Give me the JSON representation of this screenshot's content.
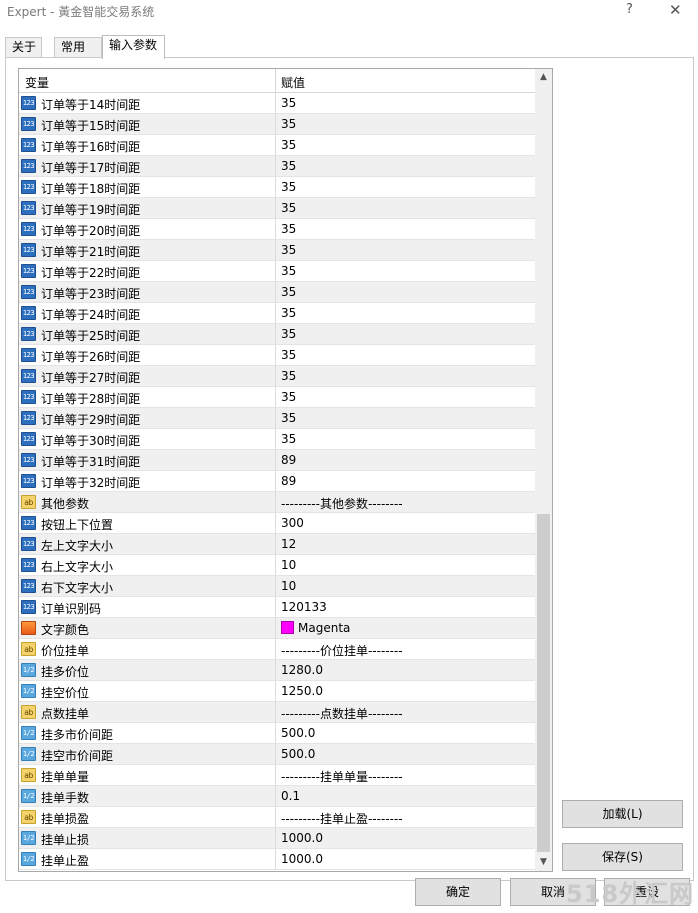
{
  "window": {
    "title": "Expert - 黃金智能交易系统",
    "help_glyph": "?",
    "close_glyph": "✕"
  },
  "tabs": [
    "关于",
    "常用",
    "输入参数"
  ],
  "grid": {
    "headers": [
      "变量",
      "赋值"
    ],
    "rows": [
      {
        "icon": "int",
        "icon_text": "123",
        "name": "订单等于14时间距",
        "value": "35"
      },
      {
        "icon": "int",
        "icon_text": "123",
        "name": "订单等于15时间距",
        "value": "35"
      },
      {
        "icon": "int",
        "icon_text": "123",
        "name": "订单等于16时间距",
        "value": "35"
      },
      {
        "icon": "int",
        "icon_text": "123",
        "name": "订单等于17时间距",
        "value": "35"
      },
      {
        "icon": "int",
        "icon_text": "123",
        "name": "订单等于18时间距",
        "value": "35"
      },
      {
        "icon": "int",
        "icon_text": "123",
        "name": "订单等于19时间距",
        "value": "35"
      },
      {
        "icon": "int",
        "icon_text": "123",
        "name": "订单等于20时间距",
        "value": "35"
      },
      {
        "icon": "int",
        "icon_text": "123",
        "name": "订单等于21时间距",
        "value": "35"
      },
      {
        "icon": "int",
        "icon_text": "123",
        "name": "订单等于22时间距",
        "value": "35"
      },
      {
        "icon": "int",
        "icon_text": "123",
        "name": "订单等于23时间距",
        "value": "35"
      },
      {
        "icon": "int",
        "icon_text": "123",
        "name": "订单等于24时间距",
        "value": "35"
      },
      {
        "icon": "int",
        "icon_text": "123",
        "name": "订单等于25时间距",
        "value": "35"
      },
      {
        "icon": "int",
        "icon_text": "123",
        "name": "订单等于26时间距",
        "value": "35"
      },
      {
        "icon": "int",
        "icon_text": "123",
        "name": "订单等于27时间距",
        "value": "35"
      },
      {
        "icon": "int",
        "icon_text": "123",
        "name": "订单等于28时间距",
        "value": "35"
      },
      {
        "icon": "int",
        "icon_text": "123",
        "name": "订单等于29时间距",
        "value": "35"
      },
      {
        "icon": "int",
        "icon_text": "123",
        "name": "订单等于30时间距",
        "value": "35"
      },
      {
        "icon": "int",
        "icon_text": "123",
        "name": "订单等于31时间距",
        "value": "89"
      },
      {
        "icon": "int",
        "icon_text": "123",
        "name": "订单等于32时间距",
        "value": "89"
      },
      {
        "icon": "str",
        "icon_text": "ab",
        "name": "其他参数",
        "value": "---------其他参数--------"
      },
      {
        "icon": "int",
        "icon_text": "123",
        "name": "按钮上下位置",
        "value": "300"
      },
      {
        "icon": "int",
        "icon_text": "123",
        "name": "左上文字大小",
        "value": "12"
      },
      {
        "icon": "int",
        "icon_text": "123",
        "name": "右上文字大小",
        "value": "10"
      },
      {
        "icon": "int",
        "icon_text": "123",
        "name": "右下文字大小",
        "value": "10"
      },
      {
        "icon": "int",
        "icon_text": "123",
        "name": "订单识别码",
        "value": "120133"
      },
      {
        "icon": "clr",
        "icon_text": "",
        "name": "文字颜色",
        "value": "Magenta",
        "swatch": "#ff00ff"
      },
      {
        "icon": "str",
        "icon_text": "ab",
        "name": "价位挂单",
        "value": "---------价位挂单--------"
      },
      {
        "icon": "dbl",
        "icon_text": "1/2",
        "name": "挂多价位",
        "value": "1280.0"
      },
      {
        "icon": "dbl",
        "icon_text": "1/2",
        "name": "挂空价位",
        "value": "1250.0"
      },
      {
        "icon": "str",
        "icon_text": "ab",
        "name": "点数挂单",
        "value": "---------点数挂单--------"
      },
      {
        "icon": "dbl",
        "icon_text": "1/2",
        "name": "挂多市价间距",
        "value": "500.0"
      },
      {
        "icon": "dbl",
        "icon_text": "1/2",
        "name": "挂空市价间距",
        "value": "500.0"
      },
      {
        "icon": "str",
        "icon_text": "ab",
        "name": "挂单单量",
        "value": "---------挂单单量--------"
      },
      {
        "icon": "dbl",
        "icon_text": "1/2",
        "name": "挂单手数",
        "value": "0.1"
      },
      {
        "icon": "str",
        "icon_text": "ab",
        "name": "挂单损盈",
        "value": "---------挂单止盈--------"
      },
      {
        "icon": "dbl",
        "icon_text": "1/2",
        "name": "挂单止损",
        "value": "1000.0"
      },
      {
        "icon": "dbl",
        "icon_text": "1/2",
        "name": "挂单止盈",
        "value": "1000.0"
      }
    ]
  },
  "side_buttons": {
    "load": "加载(L)",
    "save": "保存(S)"
  },
  "footer_buttons": {
    "ok": "确定",
    "cancel": "取消",
    "reset": "重设"
  },
  "watermark": "518外汇网"
}
